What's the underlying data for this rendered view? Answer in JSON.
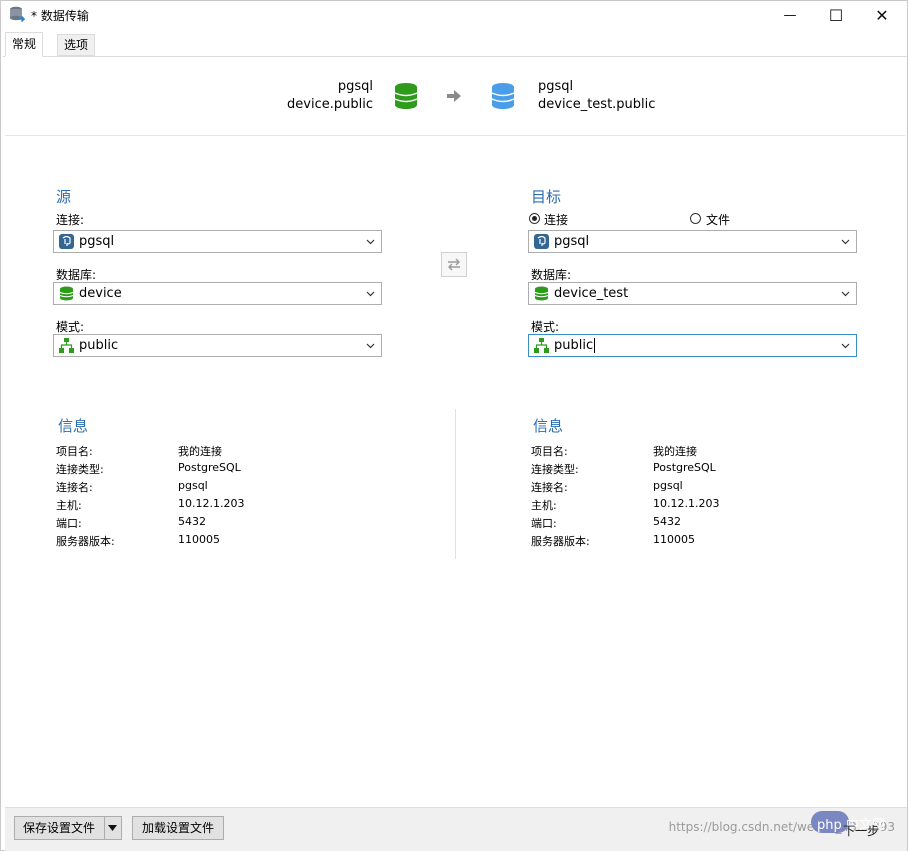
{
  "window": {
    "title": "* 数据传输",
    "minimize_glyph": "—",
    "maximize_glyph": "☐",
    "close_glyph": "✕"
  },
  "tabs": [
    {
      "label": "常规",
      "active": true
    },
    {
      "label": "选项",
      "active": false
    }
  ],
  "header": {
    "source_conn": "pgsql",
    "source_schema": "device.public",
    "target_conn": "pgsql",
    "target_schema": "device_test.public",
    "arrow_icon": "arrow-right-icon",
    "source_color": "#2e9b1d",
    "target_color": "#4a9de8"
  },
  "source": {
    "title": "源",
    "connection_label": "连接:",
    "connection_value": "pgsql",
    "database_label": "数据库:",
    "database_value": "device",
    "schema_label": "模式:",
    "schema_value": "public"
  },
  "target": {
    "title": "目标",
    "radio_connection": "连接",
    "radio_file": "文件",
    "selected_radio": "连接",
    "connection_value": "pgsql",
    "database_label": "数据库:",
    "database_value": "device_test",
    "schema_label": "模式:",
    "schema_value": "public"
  },
  "source_info": {
    "title": "信息",
    "rows": [
      {
        "key": "项目名:",
        "value": "我的连接"
      },
      {
        "key": "连接类型:",
        "value": "PostgreSQL"
      },
      {
        "key": "连接名:",
        "value": "pgsql"
      },
      {
        "key": "主机:",
        "value": "10.12.1.203"
      },
      {
        "key": "端口:",
        "value": "5432"
      },
      {
        "key": "服务器版本:",
        "value": "110005"
      }
    ]
  },
  "target_info": {
    "title": "信息",
    "rows": [
      {
        "key": "项目名:",
        "value": "我的连接"
      },
      {
        "key": "连接类型:",
        "value": "PostgreSQL"
      },
      {
        "key": "连接名:",
        "value": "pgsql"
      },
      {
        "key": "主机:",
        "value": "10.12.1.203"
      },
      {
        "key": "端口:",
        "value": "5432"
      },
      {
        "key": "服务器版本:",
        "value": "110005"
      }
    ]
  },
  "footer": {
    "save_label": "保存设置文件",
    "load_label": "加载设置文件",
    "next_label": "下一步",
    "watermark": "https://blog.csdn.net/weixin_43....393",
    "php_badge": "php 中文网"
  }
}
